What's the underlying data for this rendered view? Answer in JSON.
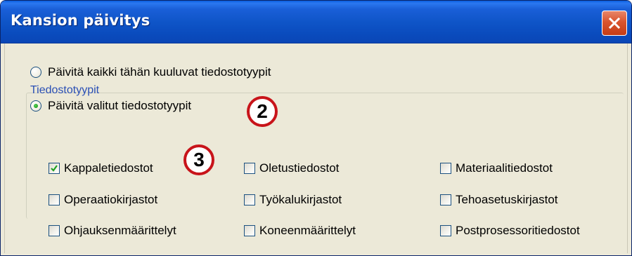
{
  "window": {
    "title": "Kansion päivitys",
    "close_icon": "close-x-icon",
    "accent_color": "#0a4bbd",
    "close_color": "#d9542e"
  },
  "options": {
    "all_types_label": "Päivitä kaikki tähän kuuluvat tiedostotyypit",
    "selected_types_label": "Päivitä valitut tiedostotyypit",
    "selected": "selected_types"
  },
  "file_types": {
    "group_label": "Tiedostotyypit",
    "items": [
      {
        "label": "Kappaletiedostot",
        "checked": true
      },
      {
        "label": "Oletustiedostot",
        "checked": false
      },
      {
        "label": "Materiaalitiedostot",
        "checked": false
      },
      {
        "label": "Operaatiokirjastot",
        "checked": false
      },
      {
        "label": "Työkalukirjastot",
        "checked": false
      },
      {
        "label": "Tehoasetuskirjastot",
        "checked": false
      },
      {
        "label": "Ohjauksenmäärittelyt",
        "checked": false
      },
      {
        "label": "Koneenmäärittelyt",
        "checked": false
      },
      {
        "label": "Postprosessoritiedostot",
        "checked": false
      }
    ]
  },
  "callouts": {
    "step_2": "2",
    "step_3": "3",
    "color": "#c8141a"
  }
}
